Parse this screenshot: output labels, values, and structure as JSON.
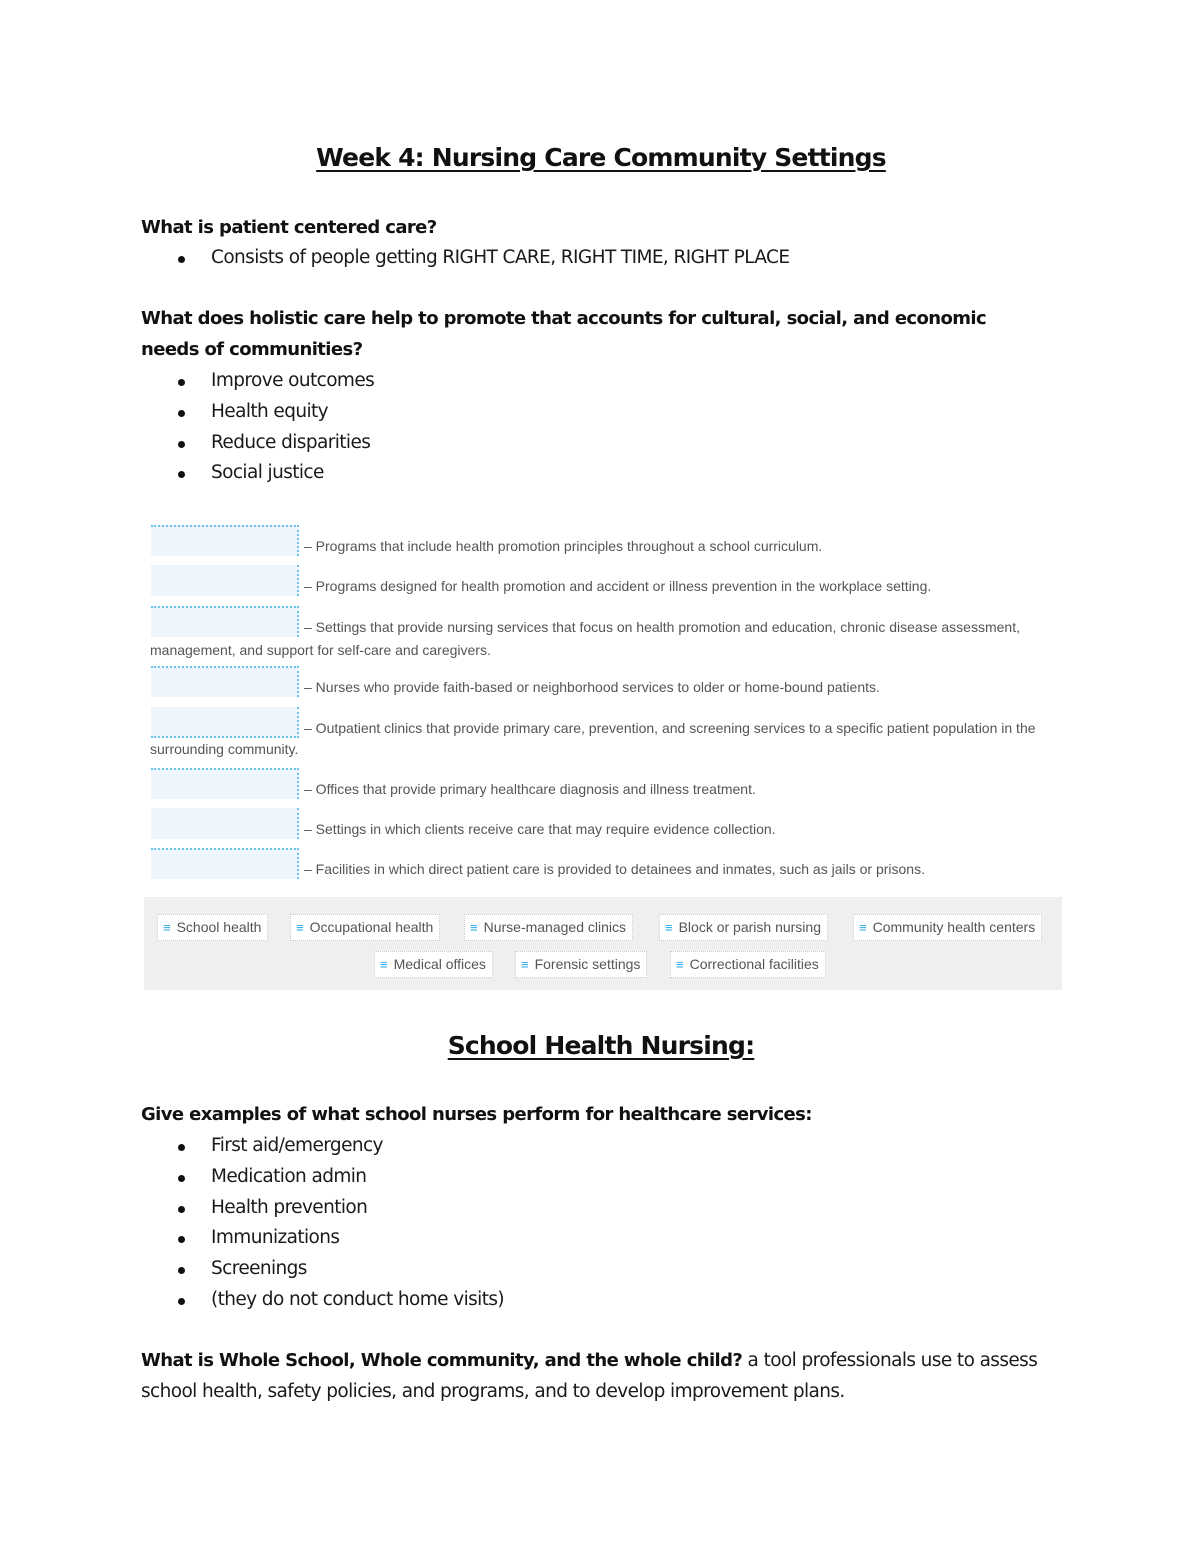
{
  "document": {
    "title": "Week 4: Nursing Care Community Settings",
    "sections": [
      {
        "question": "What is patient centered care?",
        "bullets": [
          "Consists of people getting RIGHT CARE, RIGHT TIME, RIGHT PLACE"
        ]
      },
      {
        "question": "What does holistic care help to promote that accounts for cultural, social, and economic needs of communities?",
        "bullets": [
          "Improve outcomes",
          "Health equity",
          "Reduce disparities",
          "Social justice"
        ]
      }
    ],
    "matching_exercise": {
      "items": [
        {
          "description": "– Programs that include health promotion principles throughout a school curriculum.",
          "continuation": ""
        },
        {
          "description": "– Programs designed for health promotion and accident or illness prevention in the workplace setting.",
          "continuation": ""
        },
        {
          "description": "– Settings that provide nursing services that focus on health promotion and education, chronic disease assessment,",
          "continuation": "management, and support for self-care and caregivers."
        },
        {
          "description": "– Nurses who provide faith-based or neighborhood services to older or home-bound patients.",
          "continuation": ""
        },
        {
          "description": "– Outpatient clinics that provide primary care, prevention, and screening services to a specific patient population in the",
          "continuation": "surrounding community."
        },
        {
          "description": "– Offices that provide primary healthcare diagnosis and illness treatment.",
          "continuation": ""
        },
        {
          "description": "– Settings in which clients receive care that may require evidence collection.",
          "continuation": ""
        },
        {
          "description": "– Facilities in which direct patient care is provided to detainees and inmates, such as jails or prisons.",
          "continuation": ""
        }
      ],
      "answer_bank": [
        "School health",
        "Occupational health",
        "Nurse-managed clinics",
        "Block or parish nursing",
        "Community health centers",
        "Medical offices",
        "Forensic settings",
        "Correctional facilities"
      ],
      "drag_handle_icon": "≡",
      "accent_color": "#29a6e8"
    },
    "school_section": {
      "title": "School Health Nursing:",
      "question": "Give examples of what school nurses perform for healthcare services:",
      "bullets": [
        "First aid/emergency",
        "Medication admin",
        "Health prevention",
        "Immunizations",
        "Screenings",
        "(they do not conduct home visits)"
      ],
      "wscc_question": "What is Whole School, Whole community, and the whole child?",
      "wscc_answer": " a tool professionals use to assess school health, safety policies, and programs, and to develop improvement plans."
    }
  }
}
